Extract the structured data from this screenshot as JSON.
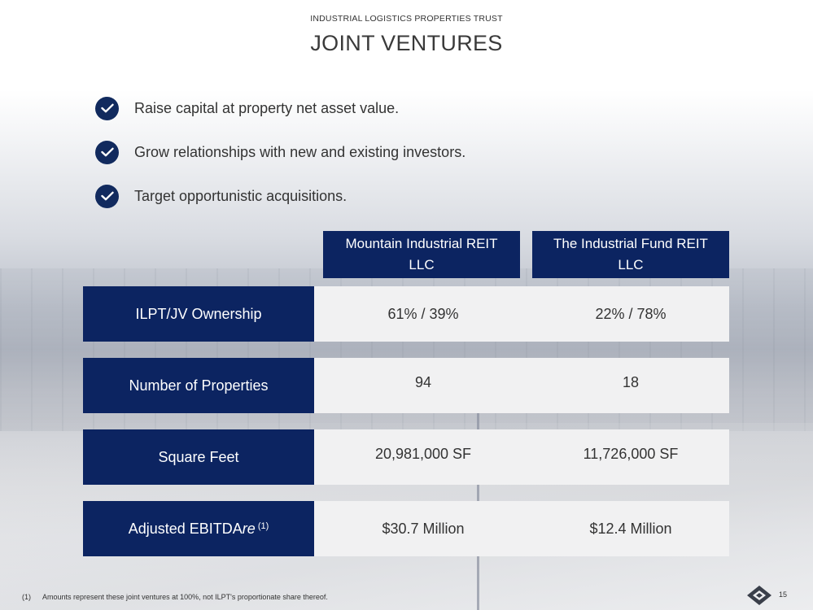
{
  "header": {
    "company": "INDUSTRIAL LOGISTICS PROPERTIES TRUST",
    "title": "JOINT VENTURES"
  },
  "bullets": [
    {
      "text": "Raise capital at property net asset value.",
      "icon": "check-circle-icon"
    },
    {
      "text": "Grow relationships with new and existing investors.",
      "icon": "check-circle-icon"
    },
    {
      "text": "Target opportunistic acquisitions.",
      "icon": "check-circle-icon"
    }
  ],
  "table": {
    "columns": [
      {
        "line1": "Mountain Industrial REIT",
        "line2": "LLC"
      },
      {
        "line1": "The Industrial Fund REIT",
        "line2": "LLC"
      }
    ],
    "rows": [
      {
        "label": "ILPT/JV Ownership",
        "values": [
          "61% / 39%",
          "22% / 78%"
        ]
      },
      {
        "label": "Number of Properties",
        "values": [
          "94",
          "18"
        ]
      },
      {
        "label": "Square Feet",
        "values": [
          "20,981,000 SF",
          "11,726,000 SF"
        ]
      },
      {
        "label": "Adjusted EBITDA",
        "label_italic": "re",
        "label_sup": "(1)",
        "values": [
          "$30.7 Million",
          "$12.4 Million"
        ]
      }
    ]
  },
  "footnote": {
    "number": "(1)",
    "text": "Amounts represent these joint ventures at 100%, not ILPT's proportionate share thereof."
  },
  "page_number": "15",
  "colors": {
    "navy": "#0c2461",
    "check_navy": "#112a5e",
    "cell_bg": "#f1f1f2"
  }
}
